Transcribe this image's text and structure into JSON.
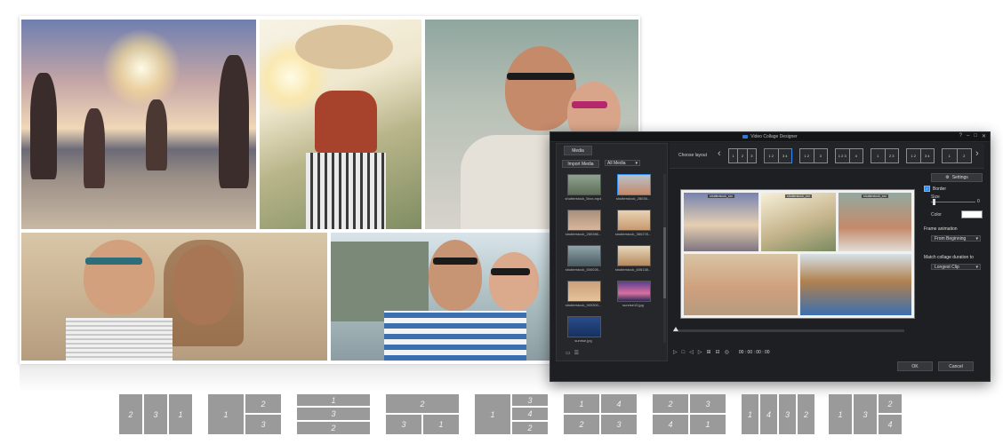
{
  "app": {
    "title": "Video Collage Designer",
    "window_controls": [
      "?",
      "–",
      "□",
      "✕"
    ],
    "media_panel": {
      "tab": "Media",
      "import_button": "Import Media",
      "filter_select": "All Media",
      "items": [
        {
          "caption": "shutterstock_5xxx.mp4",
          "selected": false
        },
        {
          "caption": "shutterstock_28036...",
          "selected": true
        },
        {
          "caption": "shutterstock_280386...",
          "selected": false
        },
        {
          "caption": "shutterstock_380278...",
          "selected": false
        },
        {
          "caption": "shutterstock_500026...",
          "selected": false
        },
        {
          "caption": "shutterstock_606138...",
          "selected": false
        },
        {
          "caption": "shutterstock_900300...",
          "selected": false
        },
        {
          "caption": "sunrise10.jpg",
          "selected": false
        },
        {
          "caption": "sunrise.jpg",
          "selected": false
        }
      ]
    },
    "layout_bar": {
      "label": "Choose layout",
      "prev": "‹",
      "next": "›",
      "layouts": [
        {
          "cells": [
            "1",
            "2",
            "3"
          ],
          "active": false
        },
        {
          "cells": [
            "1 2",
            "3 4"
          ],
          "active": true
        },
        {
          "cells": [
            "1 2",
            "3"
          ],
          "active": false
        },
        {
          "cells": [
            "1 2 3",
            "4"
          ],
          "active": false
        },
        {
          "cells": [
            "1",
            "2 3"
          ],
          "active": false
        },
        {
          "cells": [
            "1 2",
            "3 4"
          ],
          "active": false
        },
        {
          "cells": [
            "1",
            "2"
          ],
          "active": false
        }
      ]
    },
    "preview": {
      "cell_labels": [
        "shutterstock_xxx",
        "shutterstock_xxx",
        "shutterstock_xxx"
      ]
    },
    "transport": {
      "icons": [
        "▷",
        "□",
        "◁",
        "▷",
        "⊞",
        "⊟",
        "◎"
      ],
      "time": "00 : 00 : 00 : 00"
    },
    "settings": {
      "button": "Settings",
      "border_label": "Border",
      "border_checked": true,
      "size_label": "Size",
      "size_value": "0",
      "color_label": "Color",
      "border_color": "#ffffff",
      "frame_animation_label": "Frame animation",
      "frame_animation_value": "From Beginning",
      "match_duration_label": "Match collage duration to",
      "match_duration_value": "Longest Clip"
    },
    "footer": {
      "ok": "OK",
      "cancel": "Cancel"
    }
  },
  "templates": [
    {
      "cells": [
        "2",
        "3",
        "1"
      ]
    },
    {
      "cells": [
        "1",
        "2",
        "3"
      ]
    },
    {
      "cells": [
        "1",
        "3",
        "2"
      ]
    },
    {
      "cells": [
        "2",
        "3",
        "1"
      ]
    },
    {
      "cells": [
        "1",
        "3",
        "4",
        "2"
      ]
    },
    {
      "cells": [
        "1",
        "4",
        "2",
        "3"
      ]
    },
    {
      "cells": [
        "2",
        "3",
        "4",
        "1"
      ]
    },
    {
      "cells": [
        "1",
        "4",
        "3",
        "2"
      ]
    },
    {
      "cells": [
        "1",
        "3",
        "2",
        "4"
      ]
    }
  ],
  "colors": {
    "accent": "#2f8df0",
    "window_bg": "#1e1f22",
    "template_gray": "#9a9a9a"
  }
}
